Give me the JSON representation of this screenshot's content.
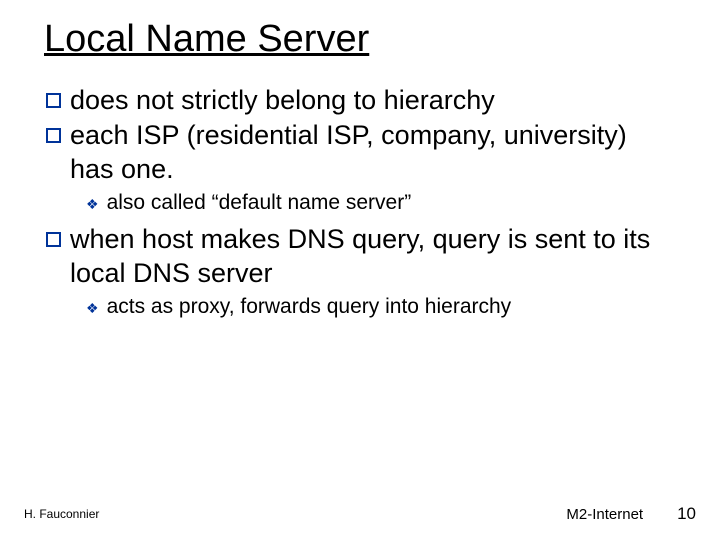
{
  "title": "Local Name Server",
  "bullets": [
    {
      "text": "does not strictly belong to hierarchy"
    },
    {
      "text": "each ISP (residential ISP, company, university) has one.",
      "sub": [
        {
          "text": "also called “default name server”"
        }
      ]
    },
    {
      "text": "when host makes DNS query, query is sent to its local DNS server",
      "sub": [
        {
          "text": "acts as proxy, forwards query into hierarchy"
        }
      ]
    }
  ],
  "footer": {
    "left": "H. Fauconnier",
    "center": "M2-Internet",
    "page": "10"
  }
}
